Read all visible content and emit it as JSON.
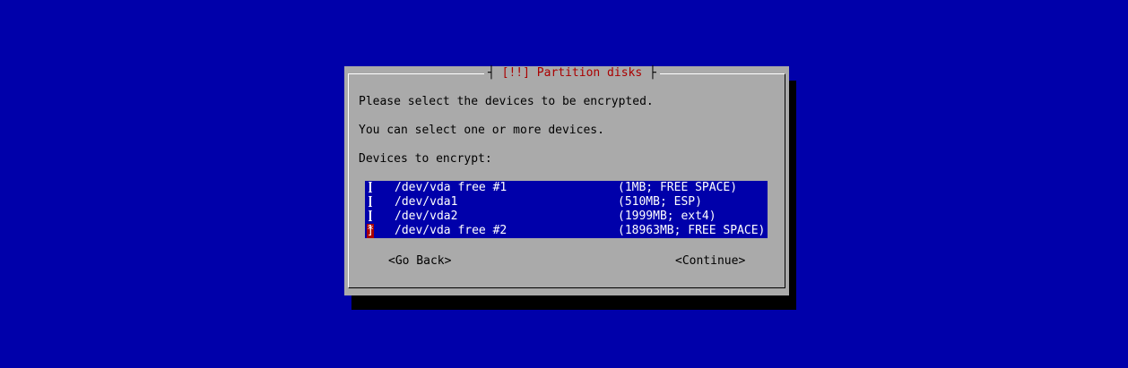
{
  "dialog": {
    "title": "[!!] Partition disks",
    "line1": "Please select the devices to be encrypted.",
    "line2": "You can select one or more devices.",
    "list_label": "Devices to encrypt:"
  },
  "devices": [
    {
      "open": "[",
      "mark": " ",
      "close": "]",
      "name": "/dev/vda free #1",
      "info": "(1MB; FREE SPACE)",
      "selected": false
    },
    {
      "open": "[",
      "mark": " ",
      "close": "]",
      "name": "/dev/vda1",
      "info": "(510MB; ESP)",
      "selected": false
    },
    {
      "open": "[",
      "mark": " ",
      "close": "]",
      "name": "/dev/vda2",
      "info": "(1999MB; ext4)",
      "selected": false
    },
    {
      "open": "[",
      "mark": "*",
      "close": "]",
      "name": "/dev/vda free #2",
      "info": "(18963MB; FREE SPACE)",
      "selected": true
    }
  ],
  "buttons": {
    "back": "<Go Back>",
    "continue": "<Continue>"
  },
  "colors": {
    "background": "#0000aa",
    "dialog": "#aaaaaa",
    "title": "#aa0000",
    "list_bg": "#0000aa",
    "list_fg": "#ffffff",
    "checkbox_highlight": "#aa0000"
  }
}
